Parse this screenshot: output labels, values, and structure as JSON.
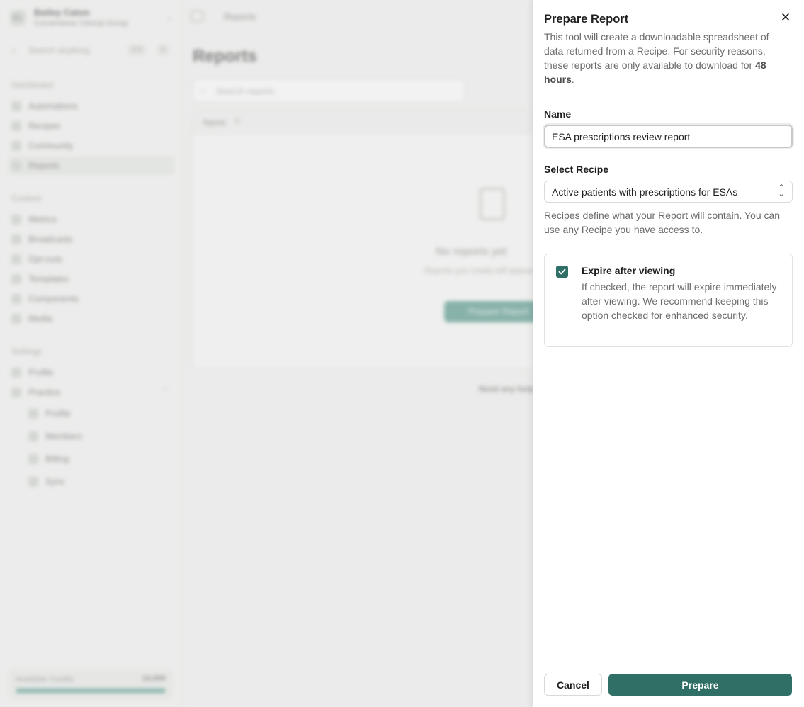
{
  "sidebar": {
    "avatar": "BC",
    "user_name": "Bailey Caton",
    "org_name": "Cornerstone Clinical Group",
    "search_placeholder": "Search anything",
    "search_kbd": "Ctrl",
    "search_kbd2": "K",
    "sections": [
      "Dashboard",
      "Content",
      "Settings"
    ],
    "dashboard_items": [
      "Automations",
      "Recipes",
      "Community",
      "Reports"
    ],
    "content_items": [
      "Metrics",
      "Broadcasts",
      "Opt-outs",
      "Templates",
      "Components",
      "Media"
    ],
    "settings_items": [
      "Profile",
      "Practice"
    ],
    "practice_sub_items": [
      "Profile",
      "Members",
      "Billing",
      "Sync"
    ],
    "credits_label": "Available Credits",
    "credits_value": "10,000",
    "credits_fraction": 1.0
  },
  "main": {
    "breadcrumb": "Reports",
    "page_title": "Reports",
    "search_placeholder": "Search reports",
    "column_name": "Name",
    "empty_title": "No reports yet",
    "empty_sub": "Reports you create will appear here",
    "empty_button": "Prepare Report",
    "footer_note": "Need any help?"
  },
  "panel": {
    "title": "Prepare Report",
    "description_before": "This tool will create a downloadable spreadsheet of data returned from a Recipe. For security reasons, these reports are only available to download for ",
    "description_bold": "48 hours",
    "description_after": ".",
    "name_label": "Name",
    "name_value": "ESA prescriptions review report",
    "recipe_label": "Select Recipe",
    "recipe_value": "Active patients with prescriptions for ESAs",
    "recipe_help": "Recipes define what your Report will contain. You can use any Recipe you have access to.",
    "expire_title": "Expire after viewing",
    "expire_desc": "If checked, the report will expire immediately after viewing. We recommend keeping this option checked for enhanced security.",
    "expire_checked": true,
    "cancel_label": "Cancel",
    "prepare_label": "Prepare"
  },
  "colors": {
    "accent": "#2f6f66",
    "panel_bg": "#ffffff"
  }
}
